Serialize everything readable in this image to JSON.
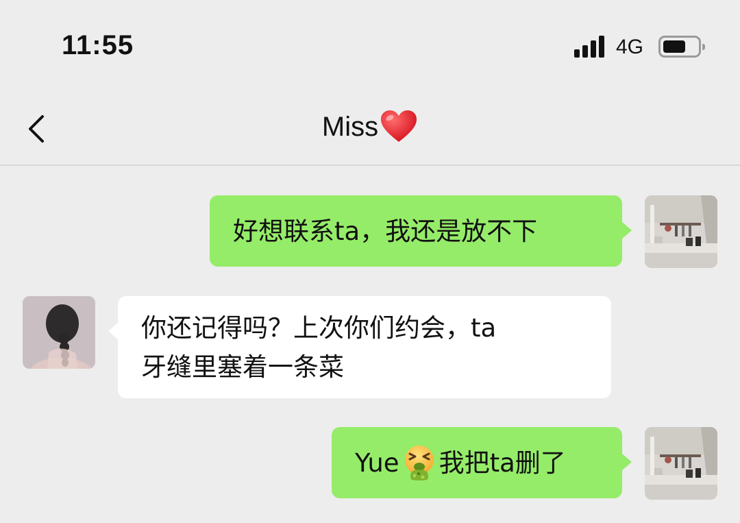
{
  "status_bar": {
    "time": "11:55",
    "network": "4G",
    "signal_icon": "signal-bars-icon",
    "battery_icon": "battery-icon"
  },
  "nav": {
    "back_icon": "chevron-left-icon",
    "title": "Miss",
    "title_emoji": "red-heart-icon"
  },
  "messages": [
    {
      "side": "right",
      "text": "好想联系ta，我还是放不下"
    },
    {
      "side": "left",
      "text_line1": "你还记得吗？上次你们约会，ta",
      "text_line2": "牙缝里塞着一条菜"
    },
    {
      "side": "right",
      "text_before": "Yue",
      "emoji": "face-vomiting-icon",
      "text_after": "我把ta删了"
    }
  ],
  "colors": {
    "background": "#ededed",
    "my_bubble": "#95ec69",
    "their_bubble": "#ffffff"
  }
}
